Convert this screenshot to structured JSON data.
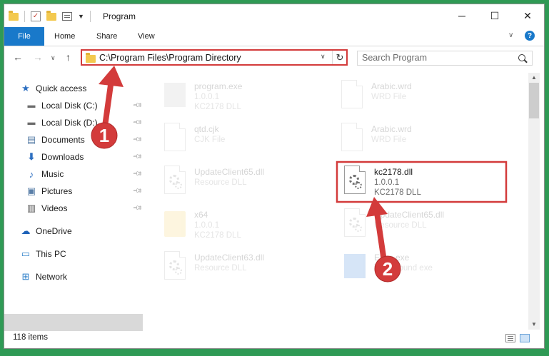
{
  "window": {
    "title": "Program",
    "controls": {
      "minimize": "─",
      "maximize": "☐",
      "close": "✕"
    }
  },
  "ribbon": {
    "tabs": [
      {
        "label": "File"
      },
      {
        "label": "Home"
      },
      {
        "label": "Share"
      },
      {
        "label": "View"
      }
    ],
    "help": "?"
  },
  "address": {
    "path": "C:\\Program Files\\Program Directory",
    "search_placeholder": "Search Program"
  },
  "nav_pane": {
    "items": [
      {
        "label": "Quick access",
        "icon": "star-icon"
      },
      {
        "label": "Local Disk (C:)",
        "icon": "drive-icon"
      },
      {
        "label": "Local Disk (D:)",
        "icon": "drive-icon"
      },
      {
        "label": "Documents",
        "icon": "documents-icon"
      },
      {
        "label": "Downloads",
        "icon": "downloads-icon"
      },
      {
        "label": "Music",
        "icon": "music-icon"
      },
      {
        "label": "Pictures",
        "icon": "pictures-icon"
      },
      {
        "label": "Videos",
        "icon": "videos-icon"
      },
      {
        "label": "OneDrive",
        "icon": "cloud-icon"
      },
      {
        "label": "This PC",
        "icon": "computer-icon"
      },
      {
        "label": "Network",
        "icon": "network-icon"
      }
    ]
  },
  "files": [
    {
      "name": "program.exe",
      "line2": "1.0.0.1",
      "line3": "KC2178 DLL",
      "icon": "exe-icon",
      "faded": true
    },
    {
      "name": "Arabic.wrd",
      "line2": "WRD File",
      "line3": "",
      "icon": "document-icon",
      "faded": true
    },
    {
      "name": "qtd.cjk",
      "line2": "CJK File",
      "line3": "",
      "icon": "document-icon",
      "faded": true
    },
    {
      "name": "Arabic.wrd",
      "line2": "WRD File",
      "line3": "",
      "icon": "document-icon",
      "faded": true
    },
    {
      "name": "UpdateClient65.dll",
      "line2": "Resource DLL",
      "line3": "",
      "icon": "dll-icon",
      "faded": true
    },
    {
      "name": "kc2178.dll",
      "line2": "1.0.0.1",
      "line3": "KC2178 DLL",
      "icon": "dll-icon",
      "faded": false
    },
    {
      "name": "x64",
      "line2": "1.0.0.1",
      "line3": "KC2178 DLL",
      "icon": "folder-icon",
      "faded": true
    },
    {
      "name": "UpdateClient65.dll",
      "line2": "Resource DLL",
      "line3": "",
      "icon": "dll-icon",
      "faded": true
    },
    {
      "name": "UpdateClient63.dll",
      "line2": "Resource DLL",
      "line3": "",
      "icon": "dll-icon",
      "faded": true
    },
    {
      "name": "Exec.exe",
      "line2": "background exe",
      "line3": "",
      "icon": "exe-icon",
      "faded": true
    }
  ],
  "status": {
    "item_count": "118 items"
  },
  "annotations": {
    "step1": "1",
    "step2": "2",
    "color": "#d33b3b"
  }
}
